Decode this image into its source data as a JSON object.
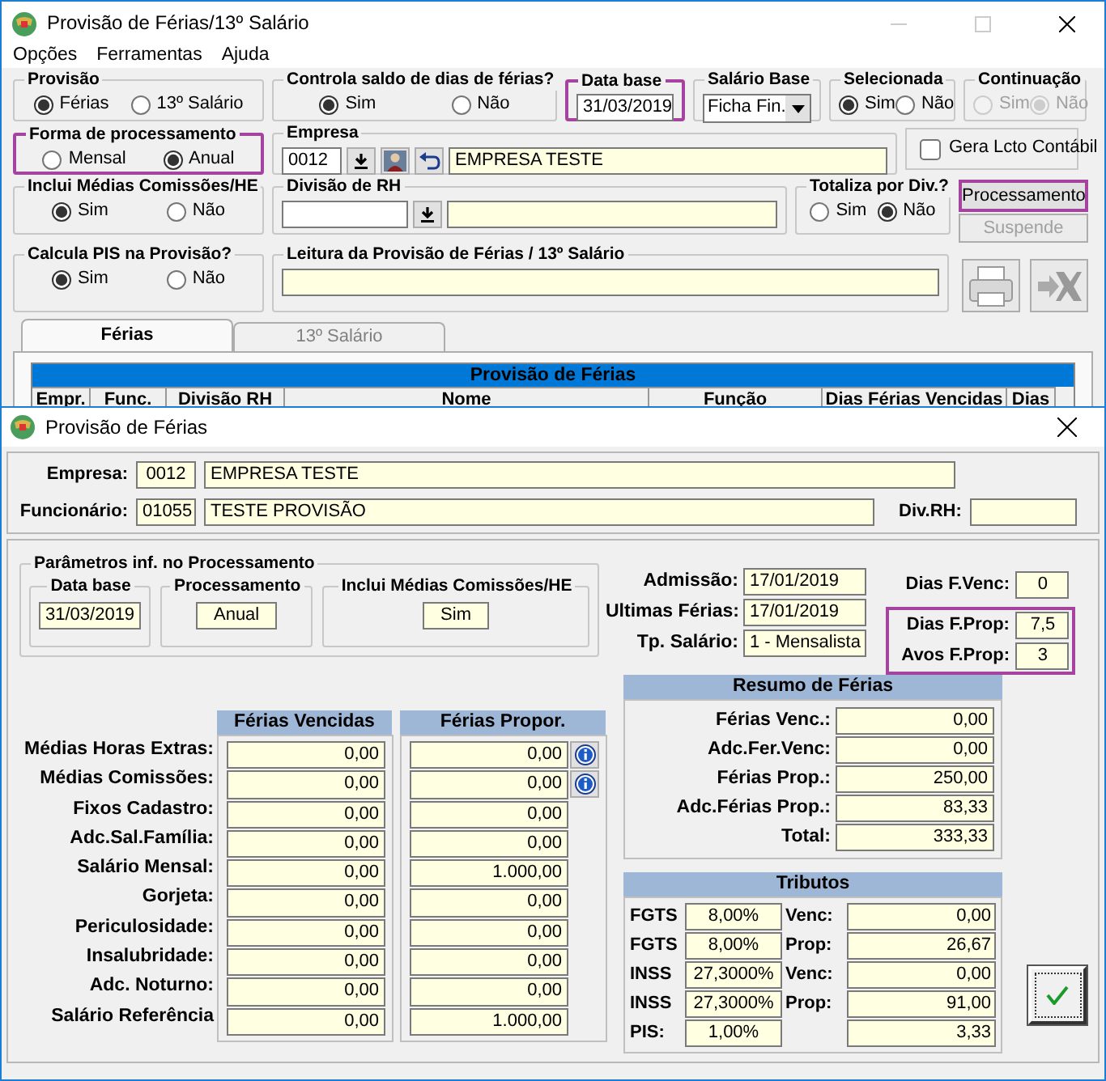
{
  "main_window": {
    "title": "Provisão de Férias/13º Salário",
    "menu": [
      "Opções",
      "Ferramentas",
      "Ajuda"
    ],
    "provisao": {
      "title": "Provisão",
      "highlighted": false,
      "options": [
        {
          "label": "Férias",
          "selected": true
        },
        {
          "label": "13º Salário",
          "selected": false
        }
      ]
    },
    "controla_saldo": {
      "title": "Controla saldo de dias de férias?",
      "options": [
        {
          "label": "Sim",
          "selected": true
        },
        {
          "label": "Não",
          "selected": false
        }
      ]
    },
    "data_base": {
      "title": "Data base",
      "value": "31/03/2019",
      "highlighted": true
    },
    "salario_base": {
      "title": "Salário Base",
      "value": "Ficha Fin."
    },
    "selecionada": {
      "title": "Selecionada",
      "options": [
        {
          "label": "Sim",
          "selected": true
        },
        {
          "label": "Não",
          "selected": false
        }
      ]
    },
    "continuacao": {
      "title": "Continuação",
      "disabled": true,
      "options": [
        {
          "label": "Sim",
          "selected": false
        },
        {
          "label": "Não",
          "selected": true
        }
      ]
    },
    "forma_processamento": {
      "title": "Forma de processamento",
      "highlighted": true,
      "options": [
        {
          "label": "Mensal",
          "selected": false
        },
        {
          "label": "Anual",
          "selected": true
        }
      ]
    },
    "empresa": {
      "title": "Empresa",
      "code": "0012",
      "name": "EMPRESA TESTE"
    },
    "gera_lcto": {
      "label": "Gera Lcto Contábil",
      "checked": false
    },
    "inclui_medias": {
      "title": "Inclui Médias Comissões/HE",
      "options": [
        {
          "label": "Sim",
          "selected": true
        },
        {
          "label": "Não",
          "selected": false
        }
      ]
    },
    "divisao_rh": {
      "title": "Divisão de RH"
    },
    "totaliza": {
      "title": "Totaliza por Div.?",
      "options": [
        {
          "label": "Sim",
          "selected": false
        },
        {
          "label": "Não",
          "selected": true
        }
      ]
    },
    "buttons": [
      {
        "label": "Processamento",
        "highlighted": true,
        "disabled": false
      },
      {
        "label": "Suspende",
        "highlighted": false,
        "disabled": true
      }
    ],
    "calcula_pis": {
      "title": "Calcula PIS na Provisão?",
      "options": [
        {
          "label": "Sim",
          "selected": true
        },
        {
          "label": "Não",
          "selected": false
        }
      ]
    },
    "leitura": {
      "title": "Leitura da Provisão de Férias / 13º Salário"
    },
    "tabs": [
      {
        "label": "Férias",
        "selected": true
      },
      {
        "label": "13º Salário",
        "selected": false
      }
    ],
    "grid": {
      "title": "Provisão de Férias",
      "columns": [
        "Empr.",
        "Func.",
        "Divisão RH",
        "Nome",
        "Função",
        "Dias Férias Vencidas",
        "Dias"
      ]
    }
  },
  "dialog": {
    "title": "Provisão de Férias",
    "empresa": {
      "label": "Empresa:",
      "code": "0012",
      "name": "EMPRESA TESTE"
    },
    "funcionario": {
      "label": "Funcionário:",
      "code": "01055",
      "name": "TESTE PROVISÃO"
    },
    "div_rh": {
      "label": "Div.RH:"
    },
    "parametros": {
      "title": "Parâmetros inf. no Processamento",
      "fields": [
        {
          "title": "Data base",
          "value": "31/03/2019"
        },
        {
          "title": "Processamento",
          "value": "Anual"
        },
        {
          "title": "Inclui Médias Comissões/HE",
          "value": "Sim"
        }
      ]
    },
    "info": [
      {
        "label": "Admissão:",
        "value": "17/01/2019"
      },
      {
        "label": "Ultimas Férias:",
        "value": "17/01/2019"
      },
      {
        "label": "Tp. Salário:",
        "value": "1 - Mensalista"
      }
    ],
    "dias_groups": [
      {
        "highlighted": false,
        "rows": [
          {
            "label": "Dias F.Venc:",
            "value": "0"
          }
        ]
      },
      {
        "highlighted": true,
        "rows": [
          {
            "label": "Dias F.Prop:",
            "value": "7,5"
          },
          {
            "label": "Avos F.Prop:",
            "value": "3"
          }
        ]
      }
    ],
    "medias": {
      "columns": [
        "Férias Vencidas",
        "Férias Propor."
      ],
      "rows": [
        {
          "label": "Médias Horas Extras:",
          "vencidas": "0,00",
          "propor": "0,00",
          "info": true
        },
        {
          "label": "Médias Comissões:",
          "vencidas": "0,00",
          "propor": "0,00",
          "info": true
        },
        {
          "label": "Fixos Cadastro:",
          "vencidas": "0,00",
          "propor": "0,00",
          "info": false
        },
        {
          "label": "Adc.Sal.Família:",
          "vencidas": "0,00",
          "propor": "0,00",
          "info": false
        },
        {
          "label": "Salário Mensal:",
          "vencidas": "0,00",
          "propor": "1.000,00",
          "info": false
        },
        {
          "label": "Gorjeta:",
          "vencidas": "0,00",
          "propor": "0,00",
          "info": false
        },
        {
          "label": "Periculosidade:",
          "vencidas": "0,00",
          "propor": "0,00",
          "info": false
        },
        {
          "label": "Insalubridade:",
          "vencidas": "0,00",
          "propor": "0,00",
          "info": false
        },
        {
          "label": "Adc. Noturno:",
          "vencidas": "0,00",
          "propor": "0,00",
          "info": false
        },
        {
          "label": "Salário Referência",
          "vencidas": "0,00",
          "propor": "1.000,00",
          "info": false
        }
      ]
    },
    "resumo": {
      "title": "Resumo de Férias",
      "rows": [
        {
          "label": "Férias Venc.:",
          "value": "0,00"
        },
        {
          "label": "Adc.Fer.Venc:",
          "value": "0,00"
        },
        {
          "label": "Férias Prop.:",
          "value": "250,00"
        },
        {
          "label": "Adc.Férias Prop.:",
          "value": "83,33"
        },
        {
          "label": "Total:",
          "value": "333,33"
        }
      ]
    },
    "tributos": {
      "title": "Tributos",
      "rows": [
        {
          "name": "FGTS",
          "rate": "8,00%",
          "period": "Venc:",
          "value": "0,00"
        },
        {
          "name": "FGTS",
          "rate": "8,00%",
          "period": "Prop:",
          "value": "26,67"
        },
        {
          "name": "INSS",
          "rate": "27,3000%",
          "period": "Venc:",
          "value": "0,00"
        },
        {
          "name": "INSS",
          "rate": "27,3000%",
          "period": "Prop:",
          "value": "91,00"
        },
        {
          "name": "PIS:",
          "rate": "1,00%",
          "value": "3,33"
        }
      ]
    }
  }
}
